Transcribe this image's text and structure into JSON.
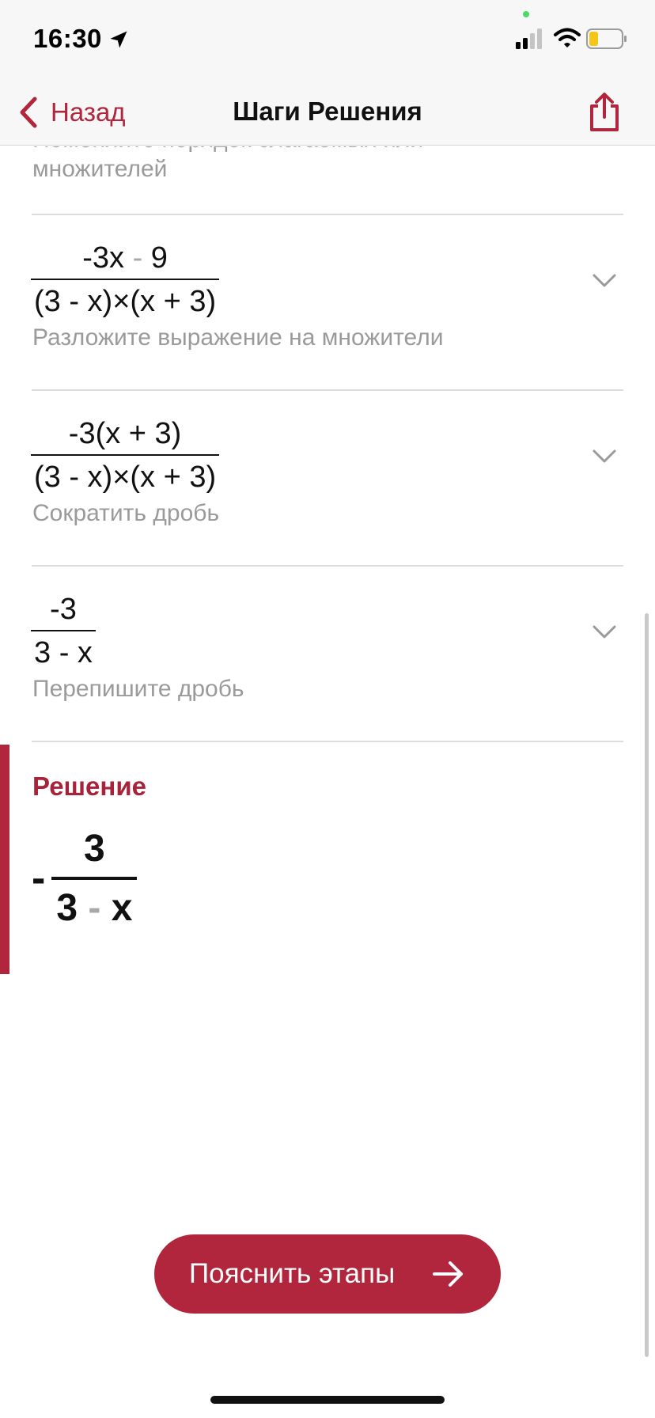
{
  "status_bar": {
    "time": "16:30"
  },
  "nav": {
    "back_label": "Назад",
    "title": "Шаги Решения"
  },
  "steps_partial": {
    "description": "Поменяйте порядок слагаемых или множителей"
  },
  "steps": [
    {
      "numerator": [
        "-",
        "3x",
        "-",
        "9"
      ],
      "denominator": "(3 - x)×(x + 3)",
      "description": "Разложите выражение на множители"
    },
    {
      "numerator": "-3(x + 3)",
      "denominator": "(3 - x)×(x + 3)",
      "description": "Сократить дробь"
    },
    {
      "numerator": "-3",
      "denominator": "3 - x",
      "description": "Перепишите дробь"
    }
  ],
  "solution": {
    "title": "Решение",
    "sign": "-",
    "numerator": "3",
    "denominator_left": "3",
    "denominator_op": "-",
    "denominator_right": "x"
  },
  "explain_button": {
    "label": "Пояснить этапы"
  },
  "icons": {
    "location": "location-arrow-icon",
    "signal": "signal-icon",
    "wifi": "wifi-icon",
    "battery": "battery-icon",
    "back": "chevron-left-icon",
    "share": "share-icon",
    "expand": "chevron-down-icon",
    "arrow": "arrow-right-icon"
  },
  "colors": {
    "accent": "#b1263c",
    "muted_text": "#9a9a9a",
    "operator": "#a8a8a8",
    "bar_background": "#f7f7f7"
  }
}
